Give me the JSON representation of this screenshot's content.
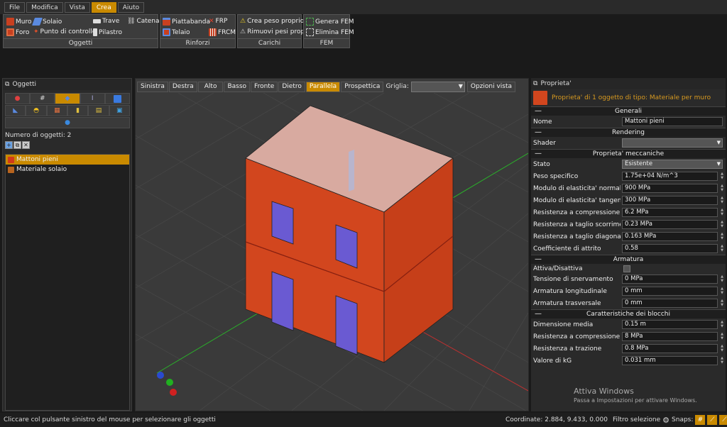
{
  "menu": [
    "File",
    "Modifica",
    "Vista",
    "Crea",
    "Aiuto"
  ],
  "menu_active": "Crea",
  "ribbon": {
    "oggetti": {
      "title": "Oggetti",
      "muro": "Muro",
      "solaio": "Solaio",
      "trave": "Trave",
      "catena": "Catena",
      "foro": "Foro",
      "punto": "Punto di controllo",
      "pilastro": "Pilastro"
    },
    "rinforzi": {
      "title": "Rinforzi",
      "piattabanda": "Piattabanda",
      "frp": "FRP",
      "telaio": "Telaio",
      "frcm": "FRCM"
    },
    "carichi": {
      "title": "Carichi",
      "crea": "Crea peso proprio",
      "rimuovi": "Rimuovi pesi propri"
    },
    "fem": {
      "title": "FEM",
      "genera": "Genera FEM",
      "elimina": "Elimina FEM"
    }
  },
  "left": {
    "title": "Oggetti",
    "count": "Numero di oggetti: 2",
    "items": [
      {
        "label": "Mattoni pieni",
        "color": "#d23a1a"
      },
      {
        "label": "Materiale solaio",
        "color": "#b8641e"
      }
    ]
  },
  "viewport": {
    "buttons": [
      "Sinistra",
      "Destra",
      "Alto",
      "Basso",
      "Fronte",
      "Dietro",
      "Parallela",
      "Prospettica"
    ],
    "active": "Parallela",
    "grid_label": "Griglia:",
    "grid_value": "",
    "options": "Opzioni vista"
  },
  "right": {
    "title": "Proprieta'",
    "sel_info": "Proprieta' di 1 oggetto di tipo: Materiale per muro",
    "generali": {
      "title": "Generali",
      "nome_label": "Nome",
      "nome": "Mattoni pieni"
    },
    "rendering": {
      "title": "Rendering",
      "shader_label": "Shader",
      "shader": ""
    },
    "meccaniche": {
      "title": "Proprieta' meccaniche",
      "rows": [
        {
          "label": "Stato",
          "value": "Esistente",
          "type": "select"
        },
        {
          "label": "Peso specifico",
          "value": "1.75e+04 N/m^3"
        },
        {
          "label": "Modulo di elasticita' normale",
          "value": "900 MPa"
        },
        {
          "label": "Modulo di elasticita' tangenziale",
          "value": "300 MPa"
        },
        {
          "label": "Resistenza a compressione",
          "value": "6.2 MPa"
        },
        {
          "label": "Resistenza a taglio scorrimento",
          "value": "0.23 MPa"
        },
        {
          "label": "Resistenza a taglio diagonale",
          "value": "0.163 MPa"
        },
        {
          "label": "Coefficiente di attrito",
          "value": "0.58"
        }
      ]
    },
    "armatura": {
      "title": "Armatura",
      "attiva_label": "Attiva/Disattiva",
      "rows": [
        {
          "label": "Tensione di snervamento",
          "value": "0 MPa"
        },
        {
          "label": "Armatura longitudinale",
          "value": "0 mm"
        },
        {
          "label": "Armatura trasversale",
          "value": "0 mm"
        }
      ]
    },
    "blocchi": {
      "title": "Caratteristiche dei blocchi",
      "rows": [
        {
          "label": "Dimensione media",
          "value": "0.15 m"
        },
        {
          "label": "Resistenza a compressione",
          "value": "8 MPa"
        },
        {
          "label": "Resistenza a trazione",
          "value": "0.8 MPa"
        },
        {
          "label": "Valore di kG",
          "value": "0.031 mm"
        }
      ]
    }
  },
  "watermark": {
    "title": "Attiva Windows",
    "sub": "Passa a Impostazioni per attivare Windows."
  },
  "status": {
    "message": "Cliccare col pulsante sinistro del mouse per selezionare gli oggetti",
    "coords": "Coordinate: 2.884, 9.433, 0.000",
    "filter": "Filtro selezione",
    "snaps": "Snaps:"
  },
  "colors": {
    "accent": "#c98a00",
    "wall": "#d2461e",
    "window": "#6a5ad2"
  }
}
